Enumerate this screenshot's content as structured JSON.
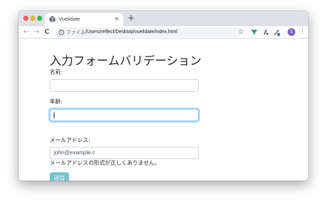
{
  "browser": {
    "tab": {
      "title": "Vuelidate",
      "close_icon": "×"
    },
    "new_tab_icon": "+",
    "nav": {
      "back_icon": "←",
      "forward_icon": "→",
      "reload_icon": "C"
    },
    "omnibox": {
      "info_icon": "i",
      "scheme_label": "ファイル",
      "url": "/Users/reffect/Desktop/vuelidate/index.html"
    },
    "bookmark_icon": "☆",
    "profile_initial": "S",
    "menu_icon": "⋮"
  },
  "page": {
    "title": "入力フォームバリデーション",
    "fields": [
      {
        "label": "名前:",
        "value": ""
      },
      {
        "label": "年齢:",
        "value": ""
      },
      {
        "label": "メールアドレス:",
        "value": "john@example.c"
      }
    ],
    "email_error": "メールアドレスの形式が正しくありません。",
    "submit_label": "送信"
  },
  "colors": {
    "submit_button": "#74c3cf",
    "focus_ring": "#80bdff",
    "tab_strip": "#dee1e6"
  }
}
